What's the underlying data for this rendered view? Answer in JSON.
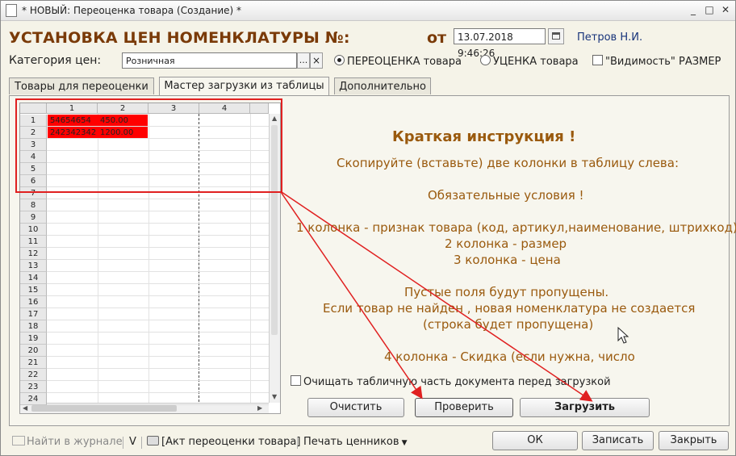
{
  "window": {
    "title": "* НОВЫЙ: Переоценка товара (Создание) *"
  },
  "header": {
    "doc_title": "УСТАНОВКА ЦЕН НОМЕНКЛАТУРЫ №:",
    "from_label": "от",
    "date": "13.07.2018  9:46:26",
    "user": "Петров Н.И."
  },
  "category": {
    "label": "Категория цен:",
    "value": "Розничная",
    "dots": "...",
    "clear": "×"
  },
  "options": {
    "revaluation": "ПЕРЕОЦЕНКА товара",
    "markdown": "УЦЕНКА товара",
    "visibility": "\"Видимость\" РАЗМЕР"
  },
  "tabs": [
    {
      "label": "Товары для переоценки"
    },
    {
      "label": "Мастер загрузки из таблицы"
    },
    {
      "label": "Дополнительно"
    }
  ],
  "sheet": {
    "columns": [
      "1",
      "2",
      "3",
      "4"
    ],
    "rows": [
      "1",
      "2",
      "3",
      "4",
      "5",
      "6",
      "7",
      "8",
      "9",
      "10",
      "11",
      "12",
      "13",
      "14",
      "15",
      "16",
      "17",
      "18",
      "19",
      "20",
      "21",
      "22",
      "23",
      "24"
    ],
    "cells": [
      [
        "54654654",
        "450.00"
      ],
      [
        "242342342",
        "1200.00"
      ]
    ]
  },
  "instructions": {
    "title": "Краткая инструкция !",
    "line1": "Скопируйте (вставьте) две колонки в таблицу слева:",
    "line2": "Обязательные условия !",
    "line3": "1 колонка - признак товара (код, артикул,наименование, штрихкод)",
    "line4": "2 колонка - размер",
    "line5": "3 колонка - цена",
    "line6": "Пустые поля будут пропущены.",
    "line7": "Если товар не найден , новая номенклатура не создается",
    "line8": "(строка будет пропущена)",
    "line9": "4 колонка - Скидка (если нужна, число"
  },
  "panel_controls": {
    "clear_checkbox": "Очищать табличную часть документа перед загрузкой",
    "clear_button": "Очистить",
    "check_button": "Проверить",
    "load_button": "Загрузить"
  },
  "footer": {
    "journal": "Найти в журнале",
    "v": "V",
    "act": "[Акт переоценки товара]",
    "price_tags": "Печать ценников",
    "ok": "ОК",
    "save": "Записать",
    "close": "Закрыть"
  },
  "colors": {
    "title_brown": "#7a3a08",
    "instruction_text": "#9a5a0e",
    "highlight_red": "#ff0000",
    "annotation_red": "#e02020"
  }
}
